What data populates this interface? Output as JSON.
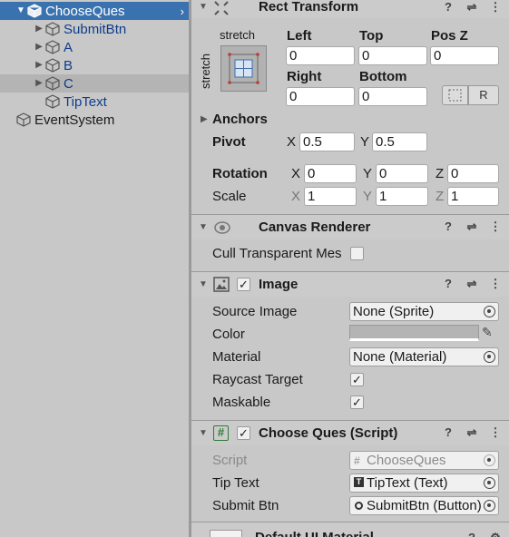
{
  "hierarchy": {
    "items": [
      {
        "label": "ChooseQues",
        "depth": 1,
        "expanded": true,
        "selected": true
      },
      {
        "label": "SubmitBtn",
        "depth": 2
      },
      {
        "label": "A",
        "depth": 2
      },
      {
        "label": "B",
        "depth": 2
      },
      {
        "label": "C",
        "depth": 2,
        "highlight": true
      },
      {
        "label": "TipText",
        "depth": 2,
        "leaf": true
      },
      {
        "label": "EventSystem",
        "depth": 0,
        "leaf": true
      }
    ]
  },
  "rect_transform": {
    "title": "Rect Transform",
    "anchor_top": "stretch",
    "anchor_side": "stretch",
    "left_label": "Left",
    "left": "0",
    "top_label": "Top",
    "top": "0",
    "posz_label": "Pos Z",
    "posz": "0",
    "right_label": "Right",
    "right": "0",
    "bottom_label": "Bottom",
    "bottom": "0",
    "raw_label": "R",
    "anchors_label": "Anchors",
    "pivot_label": "Pivot",
    "pivot_x": "0.5",
    "pivot_y": "0.5",
    "rotation_label": "Rotation",
    "rot_x": "0",
    "rot_y": "0",
    "rot_z": "0",
    "scale_label": "Scale",
    "scale_x": "1",
    "scale_y": "1",
    "scale_z": "1",
    "x": "X",
    "y": "Y",
    "z": "Z"
  },
  "canvas_renderer": {
    "title": "Canvas Renderer",
    "cull_label": "Cull Transparent Mes"
  },
  "image": {
    "title": "Image",
    "source_label": "Source Image",
    "source": "None (Sprite)",
    "color_label": "Color",
    "color": "#b4b4b4",
    "material_label": "Material",
    "material": "None (Material)",
    "raycast_label": "Raycast Target",
    "maskable_label": "Maskable"
  },
  "script": {
    "title": "Choose Ques (Script)",
    "script_label": "Script",
    "script": "ChooseQues",
    "tip_label": "Tip Text",
    "tip": "TipText (Text)",
    "submit_label": "Submit Btn",
    "submit": "SubmitBtn (Button)"
  },
  "material_footer": {
    "title": "Default UI Material"
  }
}
